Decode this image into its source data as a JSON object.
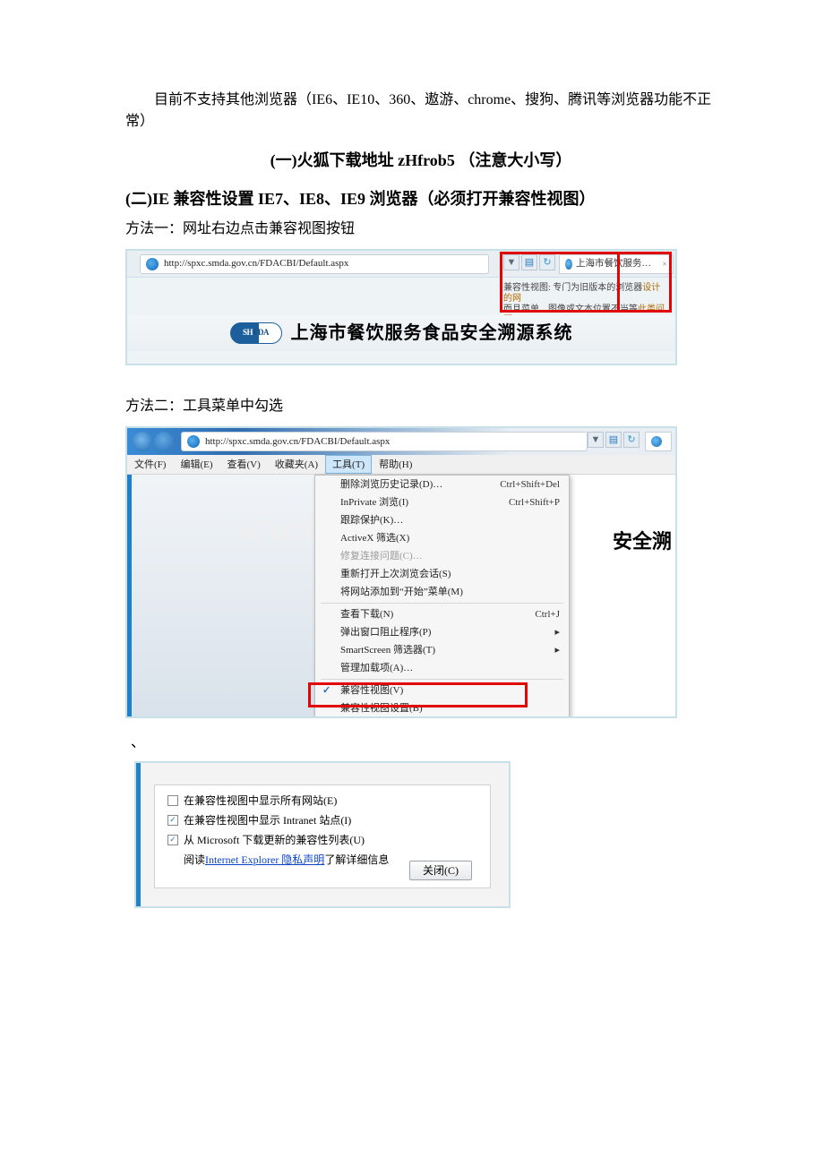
{
  "intro": "目前不支持其他浏览器（IE6、IE10、360、遨游、chrome、搜狗、腾讯等浏览器功能不正常）",
  "h1": "(一)火狐下载地址 zHfrob5  （注意大小写）",
  "h2": "(二)IE 兼容性设置 IE7、IE8、IE9 浏览器（必须打开兼容性视图）",
  "m1": "方法一：网址右边点击兼容视图按钮",
  "m2": "方法二：工具菜单中勾选",
  "tick": "、",
  "shot1": {
    "url": "http://spxc.smda.gov.cn/FDACBI/Default.aspx",
    "tabTitle": "上海市餐饮服务食品安全溯…",
    "tipA": "兼容性视图: 专门为旧版本的浏览器",
    "tipB": "而且菜单、图像或文本位置不当等",
    "tipC": "设计的网",
    "tipD": "此类问题",
    "systemTitle": "上海市餐饮服务食品安全溯源系统",
    "shfdaL": "SH",
    "shfdaR": "FDA"
  },
  "shot2": {
    "url": "http://spxc.smda.gov.cn/FDACBI/Default.aspx",
    "menu": {
      "file": "文件(F)",
      "edit": "编辑(E)",
      "view": "查看(V)",
      "fav": "收藏夹(A)",
      "tools": "工具(T)",
      "help": "帮助(H)"
    },
    "watermark": "WWW",
    "partial": "安全溯",
    "items": [
      {
        "label": "删除浏览历史记录(D)…",
        "sc": "Ctrl+Shift+Del"
      },
      {
        "label": "InPrivate 浏览(I)",
        "sc": "Ctrl+Shift+P"
      },
      {
        "label": "跟踪保护(K)…"
      },
      {
        "label": "ActiveX 筛选(X)"
      },
      {
        "label": "修复连接问题(C)…",
        "dim": true
      },
      {
        "label": "重新打开上次浏览会话(S)"
      },
      {
        "label": "将网站添加到“开始”菜单(M)"
      }
    ],
    "items2": [
      {
        "label": "查看下载(N)",
        "sc": "Ctrl+J"
      },
      {
        "label": "弹出窗口阻止程序(P)",
        "tri": "▸"
      },
      {
        "label": "SmartScreen 筛选器(T)",
        "tri": "▸"
      },
      {
        "label": "管理加载项(A)…"
      }
    ],
    "items3": [
      {
        "label": "兼容性视图(V)",
        "chk": "✓"
      },
      {
        "label": "兼容性视图设置(B)"
      }
    ]
  },
  "shot3": {
    "c1": "在兼容性视图中显示所有网站(E)",
    "c2": "在兼容性视图中显示 Intranet 站点(I)",
    "c3": "从 Microsoft 下载更新的兼容性列表(U)",
    "c4a": "阅读 ",
    "c4link": "Internet Explorer 隐私声明",
    "c4b": "了解详细信息",
    "close": "关闭(C)"
  }
}
